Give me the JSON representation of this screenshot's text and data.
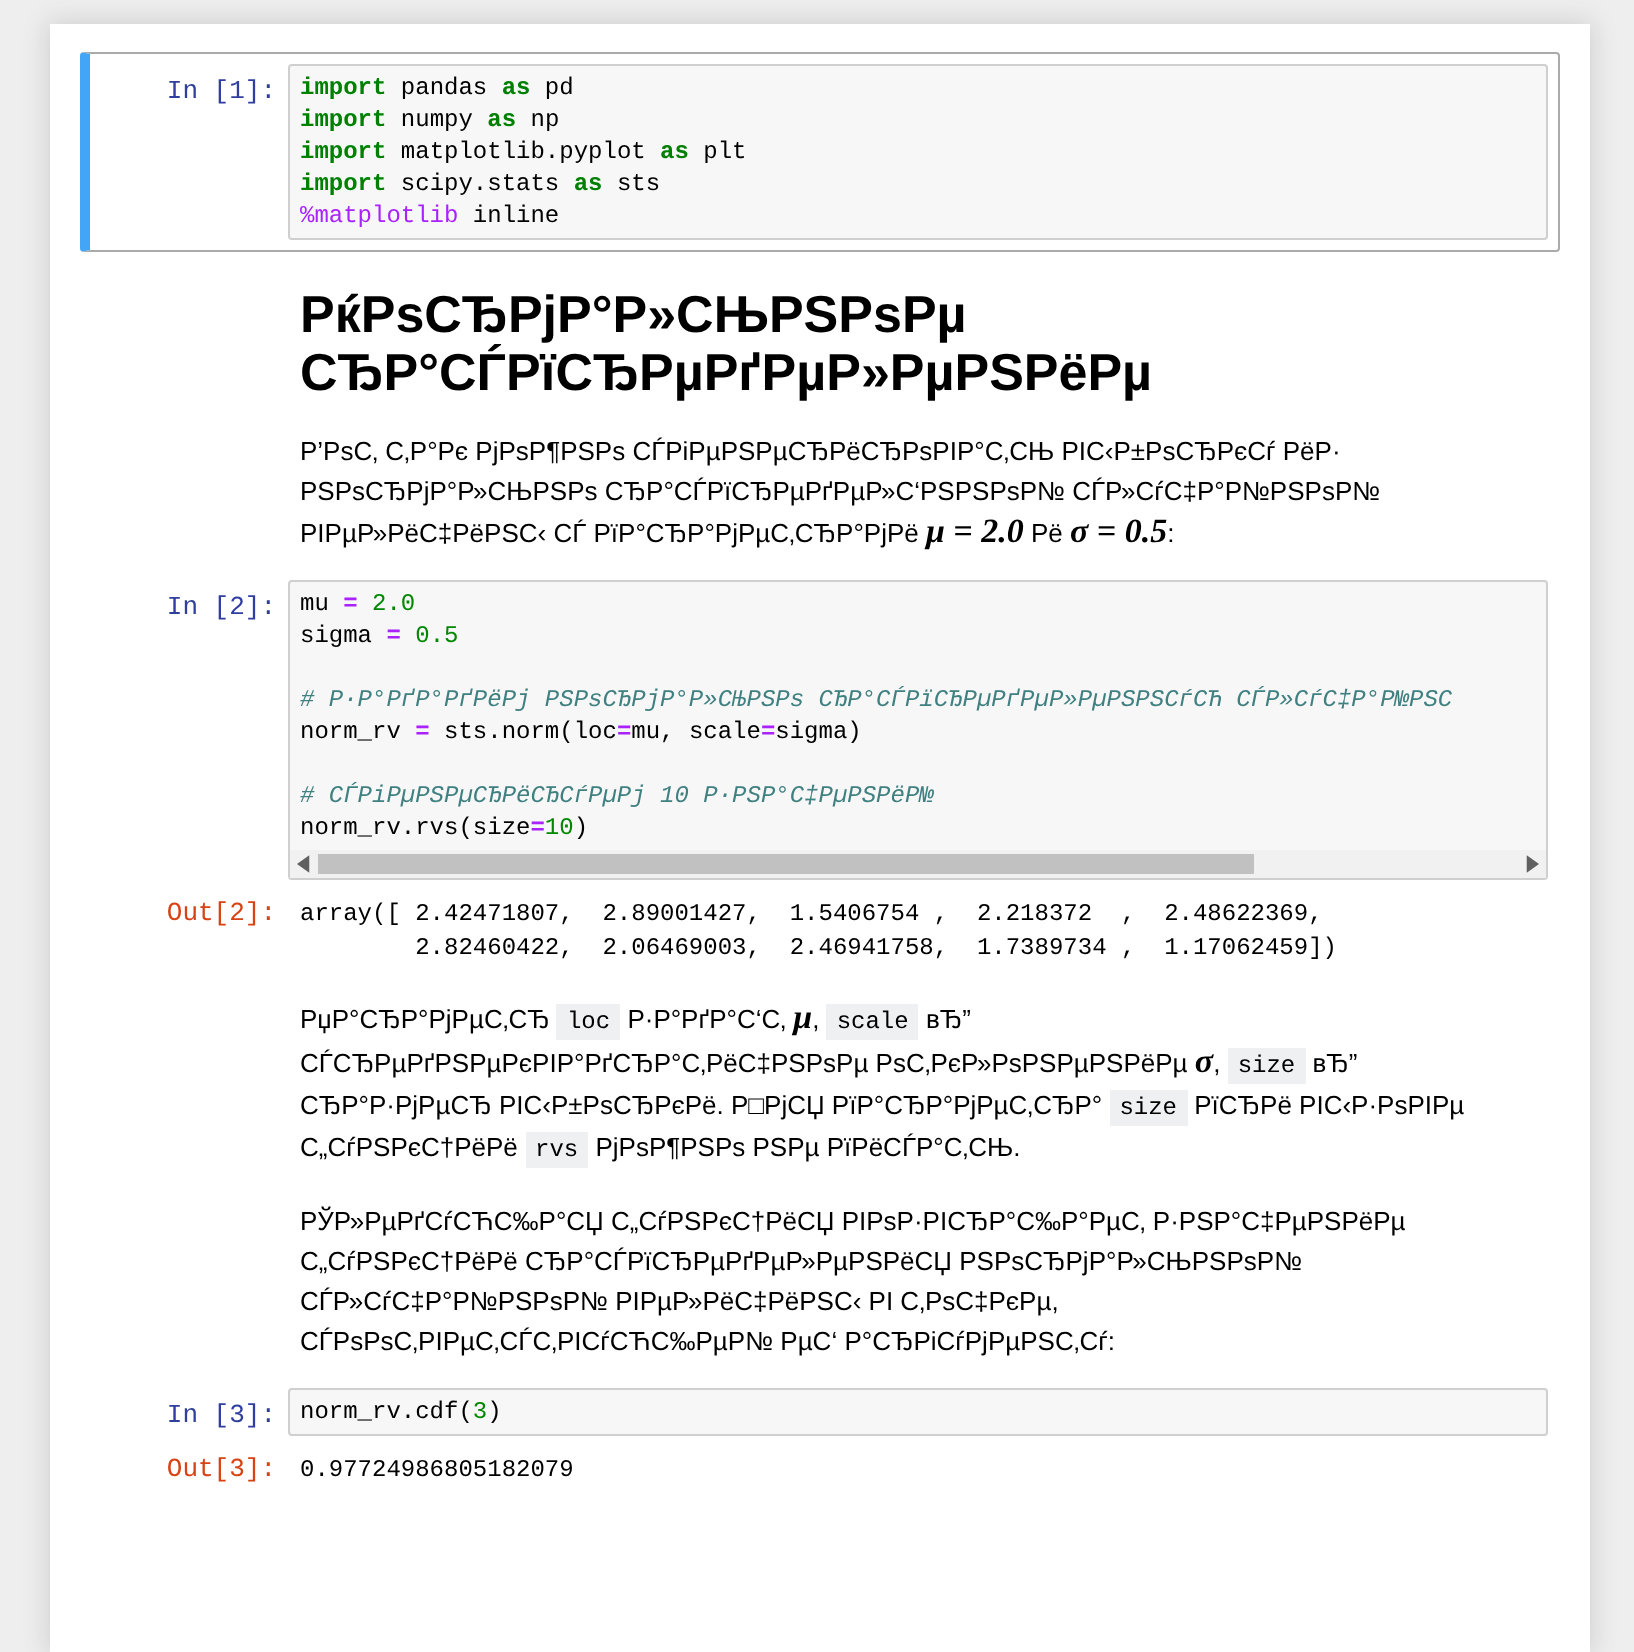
{
  "notebook": {
    "cells": [
      {
        "kind": "code",
        "selected": true,
        "prompt": "In [1]:",
        "scrollbar": false,
        "blocks": [
          [
            [
              {
                "text": "import",
                "kind": "kw"
              },
              {
                "text": " pandas ",
                "kind": "plain"
              },
              {
                "text": "as",
                "kind": "kw"
              },
              {
                "text": " pd",
                "kind": "plain"
              }
            ],
            [
              {
                "text": "import",
                "kind": "kw"
              },
              {
                "text": " numpy ",
                "kind": "plain"
              },
              {
                "text": "as",
                "kind": "kw"
              },
              {
                "text": " np",
                "kind": "plain"
              }
            ],
            [
              {
                "text": "import",
                "kind": "kw"
              },
              {
                "text": " matplotlib.pyplot ",
                "kind": "plain"
              },
              {
                "text": "as",
                "kind": "kw"
              },
              {
                "text": " plt",
                "kind": "plain"
              }
            ],
            [
              {
                "text": "import",
                "kind": "kw"
              },
              {
                "text": " scipy.stats ",
                "kind": "plain"
              },
              {
                "text": "as",
                "kind": "kw"
              },
              {
                "text": " sts",
                "kind": "plain"
              }
            ],
            [
              {
                "text": "%matplotlib",
                "kind": "magic"
              },
              {
                "text": " inline",
                "kind": "plain"
              }
            ]
          ]
        ]
      },
      {
        "kind": "heading",
        "text": "РќРѕСЂРјР°Р»СЊРЅРѕРµ СЂР°СЃРїСЂРµРґРµР»РµРЅРёРµ"
      },
      {
        "kind": "paragraph",
        "segments": [
          {
            "kind": "text",
            "text": "Р’РѕС‚ С‚Р°Рє РјРѕР¶РЅРѕ СЃРіРµРЅРµСЂРёСЂРѕРІР°С‚СЊ РІС‹Р±РѕСЂРєСѓ РёР· РЅРѕСЂРјР°Р»СЊРЅРѕ СЂР°СЃРїСЂРµРґРµР»С‘РЅРЅРѕР№ СЃР»СѓС‡Р°Р№РЅРѕР№ РІРµР»РёС‡РёРЅС‹ СЃ РїР°СЂР°РјРµС‚СЂР°РјРё "
          },
          {
            "kind": "math",
            "text": "μ = 2.0"
          },
          {
            "kind": "text",
            "text": " Рё "
          },
          {
            "kind": "math",
            "text": "σ = 0.5"
          },
          {
            "kind": "text",
            "text": ":"
          }
        ]
      },
      {
        "kind": "code",
        "selected": false,
        "prompt": "In [2]:",
        "scrollbar": true,
        "blocks": [
          [
            [
              {
                "text": "mu ",
                "kind": "plain"
              },
              {
                "text": "=",
                "kind": "op"
              },
              {
                "text": " 2.0",
                "kind": "num"
              }
            ],
            [
              {
                "text": "sigma ",
                "kind": "plain"
              },
              {
                "text": "=",
                "kind": "op"
              },
              {
                "text": " 0.5",
                "kind": "num"
              }
            ]
          ],
          [
            [
              {
                "text": "# Р·Р°РґР°РґРёРј РЅРѕСЂРјР°Р»СЊРЅРѕ СЂР°СЃРїСЂРµРґРµР»РµРЅРЅСѓСЋ СЃР»СѓС‡Р°Р№РЅС",
                "kind": "comment"
              }
            ],
            [
              {
                "text": "norm_rv ",
                "kind": "plain"
              },
              {
                "text": "=",
                "kind": "op"
              },
              {
                "text": " sts.norm(loc",
                "kind": "plain"
              },
              {
                "text": "=",
                "kind": "op"
              },
              {
                "text": "mu, scale",
                "kind": "plain"
              },
              {
                "text": "=",
                "kind": "op"
              },
              {
                "text": "sigma)",
                "kind": "plain"
              }
            ]
          ],
          [
            [
              {
                "text": "# СЃРіРµРЅРµСЂРёСЂСѓРµРј 10 Р·РЅР°С‡РµРЅРёР№",
                "kind": "comment"
              }
            ],
            [
              {
                "text": "norm_rv.rvs(size",
                "kind": "plain"
              },
              {
                "text": "=",
                "kind": "op"
              },
              {
                "text": "10",
                "kind": "num"
              },
              {
                "text": ")",
                "kind": "plain"
              }
            ]
          ]
        ]
      },
      {
        "kind": "output",
        "prompt": "Out[2]:",
        "lines": [
          "array([ 2.42471807,  2.89001427,  1.5406754 ,  2.218372  ,  2.48622369,",
          "        2.82460422,  2.06469003,  2.46941758,  1.7389734 ,  1.17062459])"
        ]
      },
      {
        "kind": "paragraph",
        "segments": [
          {
            "kind": "text",
            "text": "РџР°СЂР°РјРµС‚СЂ "
          },
          {
            "kind": "code",
            "text": "loc"
          },
          {
            "kind": "text",
            "text": " Р·Р°РґР°С‘С‚ "
          },
          {
            "kind": "math",
            "text": "μ"
          },
          {
            "kind": "text",
            "text": ", "
          },
          {
            "kind": "code",
            "text": "scale"
          },
          {
            "kind": "text",
            "text": " вЂ” СЃСЂРµРґРЅРµРєРІР°РґСЂР°С‚РёС‡РЅРѕРµ РѕС‚РєР»РѕРЅРµРЅРёРµ "
          },
          {
            "kind": "math",
            "text": "σ"
          },
          {
            "kind": "text",
            "text": ", "
          },
          {
            "kind": "code",
            "text": "size"
          },
          {
            "kind": "text",
            "text": " вЂ” СЂР°Р·РјРµСЂ РІС‹Р±РѕСЂРєРё. Р□РјСЏ РїР°СЂР°РјРµС‚СЂР° "
          },
          {
            "kind": "code",
            "text": "size"
          },
          {
            "kind": "text",
            "text": " РїСЂРё РІС‹Р·РѕРІРµ С„СѓРЅРєС†РёРё "
          },
          {
            "kind": "code",
            "text": "rvs"
          },
          {
            "kind": "text",
            "text": " РјРѕР¶РЅРѕ РЅРµ РїРёСЃР°С‚СЊ."
          }
        ]
      },
      {
        "kind": "paragraph",
        "segments": [
          {
            "kind": "text",
            "text": "РЎР»РµРґСѓСЋС‰Р°СЏ С„СѓРЅРєС†РёСЏ РІРѕР·РІСЂР°С‰Р°РµС‚ Р·РЅР°С‡РµРЅРёРµ С„СѓРЅРєС†РёРё СЂР°СЃРїСЂРµРґРµР»РµРЅРёСЏ РЅРѕСЂРјР°Р»СЊРЅРѕР№ СЃР»СѓС‡Р°Р№РЅРѕР№ РІРµР»РёС‡РёРЅС‹ РІ С‚РѕС‡РєРµ, СЃРѕРѕС‚РІРµС‚СЃС‚РІСѓСЋС‰РµР№ РµС‘ Р°СЂРіСѓРјРµРЅС‚Сѓ:"
          }
        ]
      },
      {
        "kind": "code",
        "selected": false,
        "prompt": "In [3]:",
        "scrollbar": false,
        "blocks": [
          [
            [
              {
                "text": "norm_rv.cdf(",
                "kind": "plain"
              },
              {
                "text": "3",
                "kind": "num"
              },
              {
                "text": ")",
                "kind": "plain"
              }
            ]
          ]
        ]
      },
      {
        "kind": "output",
        "prompt": "Out[3]:",
        "lines": [
          "0.97724986805182079"
        ]
      }
    ]
  }
}
